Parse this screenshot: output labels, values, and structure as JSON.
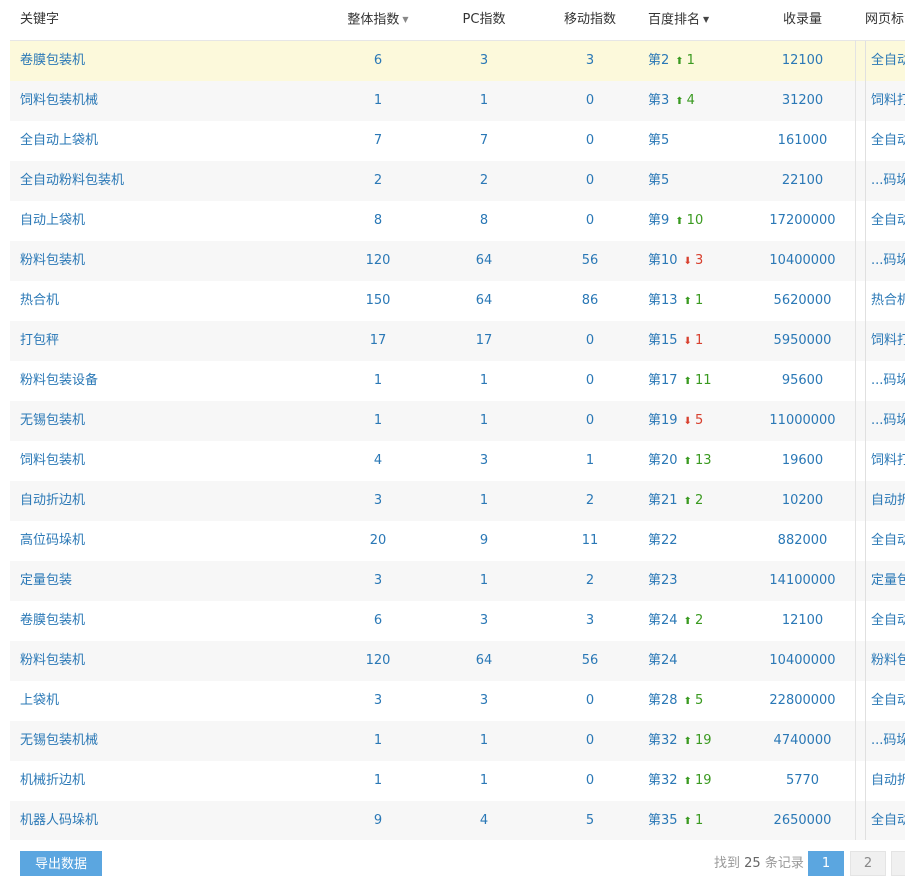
{
  "header": {
    "keyword": "关键字",
    "overall_index": "整体指数",
    "pc_index": "PC指数",
    "mobile_index": "移动指数",
    "baidu_rank": "百度排名",
    "indexed": "收录量",
    "page_title": "网页标"
  },
  "rows": [
    {
      "keyword": "卷膜包装机",
      "overall": "6",
      "pc": "3",
      "mobile": "3",
      "rank": "第2",
      "dir": "up",
      "change": "1",
      "indexed": "12100",
      "title": "全自动"
    },
    {
      "keyword": "饲料包装机械",
      "overall": "1",
      "pc": "1",
      "mobile": "0",
      "rank": "第3",
      "dir": "up",
      "change": "4",
      "indexed": "31200",
      "title": "饲料打"
    },
    {
      "keyword": "全自动上袋机",
      "overall": "7",
      "pc": "7",
      "mobile": "0",
      "rank": "第5",
      "dir": "",
      "change": "",
      "indexed": "161000",
      "title": "全自动"
    },
    {
      "keyword": "全自动粉料包装机",
      "overall": "2",
      "pc": "2",
      "mobile": "0",
      "rank": "第5",
      "dir": "",
      "change": "",
      "indexed": "22100",
      "title": "...码垛"
    },
    {
      "keyword": "自动上袋机",
      "overall": "8",
      "pc": "8",
      "mobile": "0",
      "rank": "第9",
      "dir": "up",
      "change": "10",
      "indexed": "17200000",
      "title": "全自动"
    },
    {
      "keyword": "粉料包装机",
      "overall": "120",
      "pc": "64",
      "mobile": "56",
      "rank": "第10",
      "dir": "down",
      "change": "3",
      "indexed": "10400000",
      "title": "...码垛"
    },
    {
      "keyword": "热合机",
      "overall": "150",
      "pc": "64",
      "mobile": "86",
      "rank": "第13",
      "dir": "up",
      "change": "1",
      "indexed": "5620000",
      "title": "热合机"
    },
    {
      "keyword": "打包秤",
      "overall": "17",
      "pc": "17",
      "mobile": "0",
      "rank": "第15",
      "dir": "down",
      "change": "1",
      "indexed": "5950000",
      "title": "饲料打"
    },
    {
      "keyword": "粉料包装设备",
      "overall": "1",
      "pc": "1",
      "mobile": "0",
      "rank": "第17",
      "dir": "up",
      "change": "11",
      "indexed": "95600",
      "title": "...码垛"
    },
    {
      "keyword": "无锡包装机",
      "overall": "1",
      "pc": "1",
      "mobile": "0",
      "rank": "第19",
      "dir": "down",
      "change": "5",
      "indexed": "11000000",
      "title": "...码垛"
    },
    {
      "keyword": "饲料包装机",
      "overall": "4",
      "pc": "3",
      "mobile": "1",
      "rank": "第20",
      "dir": "up",
      "change": "13",
      "indexed": "19600",
      "title": "饲料打"
    },
    {
      "keyword": "自动折边机",
      "overall": "3",
      "pc": "1",
      "mobile": "2",
      "rank": "第21",
      "dir": "up",
      "change": "2",
      "indexed": "10200",
      "title": "自动折"
    },
    {
      "keyword": "高位码垛机",
      "overall": "20",
      "pc": "9",
      "mobile": "11",
      "rank": "第22",
      "dir": "",
      "change": "",
      "indexed": "882000",
      "title": "全自动"
    },
    {
      "keyword": "定量包装",
      "overall": "3",
      "pc": "1",
      "mobile": "2",
      "rank": "第23",
      "dir": "",
      "change": "",
      "indexed": "14100000",
      "title": "定量包"
    },
    {
      "keyword": "卷膜包装机",
      "overall": "6",
      "pc": "3",
      "mobile": "3",
      "rank": "第24",
      "dir": "up",
      "change": "2",
      "indexed": "12100",
      "title": "全自动"
    },
    {
      "keyword": "粉料包装机",
      "overall": "120",
      "pc": "64",
      "mobile": "56",
      "rank": "第24",
      "dir": "",
      "change": "",
      "indexed": "10400000",
      "title": "粉料包"
    },
    {
      "keyword": "上袋机",
      "overall": "3",
      "pc": "3",
      "mobile": "0",
      "rank": "第28",
      "dir": "up",
      "change": "5",
      "indexed": "22800000",
      "title": "全自动"
    },
    {
      "keyword": "无锡包装机械",
      "overall": "1",
      "pc": "1",
      "mobile": "0",
      "rank": "第32",
      "dir": "up",
      "change": "19",
      "indexed": "4740000",
      "title": "...码垛"
    },
    {
      "keyword": "机械折边机",
      "overall": "1",
      "pc": "1",
      "mobile": "0",
      "rank": "第32",
      "dir": "up",
      "change": "19",
      "indexed": "5770",
      "title": "自动折"
    },
    {
      "keyword": "机器人码垛机",
      "overall": "9",
      "pc": "4",
      "mobile": "5",
      "rank": "第35",
      "dir": "up",
      "change": "1",
      "indexed": "2650000",
      "title": "全自动"
    }
  ],
  "footer": {
    "export_label": "导出数据",
    "found_prefix": "找到",
    "found_count": "25",
    "found_suffix": "条记录",
    "page_1": "1",
    "page_2": "2"
  },
  "colors": {
    "link": "#2a78b6",
    "up": "#3a9a20",
    "down": "#d8402e",
    "button": "#5ba6e0",
    "highlight_row": "#fcf9db"
  },
  "icons": {
    "up": "arrow-up-icon",
    "down": "arrow-down-icon",
    "sort": "sort-caret-icon"
  }
}
